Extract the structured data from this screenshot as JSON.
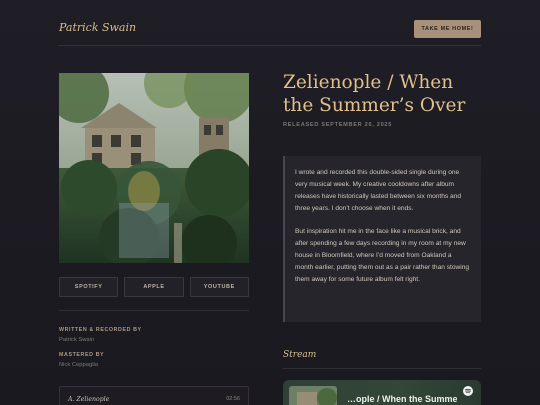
{
  "header": {
    "brand": "Patrick Swain",
    "home_button": "TAKE ME HOME!"
  },
  "cover": {
    "icon": "album-cover-art"
  },
  "services": [
    {
      "label": "SPOTIFY"
    },
    {
      "label": "APPLE"
    },
    {
      "label": "YOUTUBE"
    }
  ],
  "credits": {
    "written_label": "WRITTEN & RECORDED BY",
    "written_value": "Patrick Swain",
    "mastered_label": "MASTERED BY",
    "mastered_value": "Nick Ceppaglia"
  },
  "tracks": [
    {
      "title": "A. Zelienople",
      "time": "02:56"
    }
  ],
  "release": {
    "title": "Zelienople / When the Summer’s Over",
    "released": "RELEASED SEPTEMBER 26, 2025",
    "description": [
      "I wrote and recorded this double-sided single during one very musical week. My creative cooldowns after album releases have historically lasted between six months and three years. I don’t choose when it ends.",
      "But inspiration hit me in the face like a musical brick, and after spending a few days recording in my room at my new house in Bloomfield, where I’d moved from Oakland a month earlier, putting them out as a pair rather than stowing them away for some future album felt right."
    ]
  },
  "stream": {
    "title": "Stream",
    "embed_text": "…ople / When the Summer’s",
    "embed_icon": "spotify-icon"
  },
  "colors": {
    "accent": "#e0c08d",
    "button": "#a8917a",
    "background": "#1f1d25",
    "embed": "#324536"
  }
}
